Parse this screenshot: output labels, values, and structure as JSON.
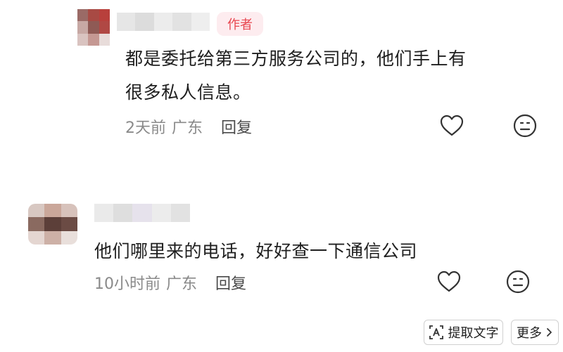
{
  "comment1": {
    "author_tag": "作者",
    "text_line1": "都是委托给第三方服务公司的，他们手上有",
    "text_line2": "很多私人信息。",
    "time": "2天前",
    "location": "广东",
    "reply": "回复"
  },
  "comment2": {
    "text": "他们哪里来的电话，好好查一下通信公司",
    "time": "10小时前",
    "location": "广东",
    "reply": "回复"
  },
  "toolbar": {
    "extract_text": "提取文字",
    "more": "更多"
  },
  "icons": {
    "like": "heart-icon",
    "emoji": "emoji-icon",
    "extract": "text-extract-icon",
    "more_arrow": "chevron-right-icon"
  },
  "colors": {
    "author_tag_bg": "#fdecef",
    "author_tag_text": "#e8464f",
    "meta_text": "#8a8a8a"
  }
}
